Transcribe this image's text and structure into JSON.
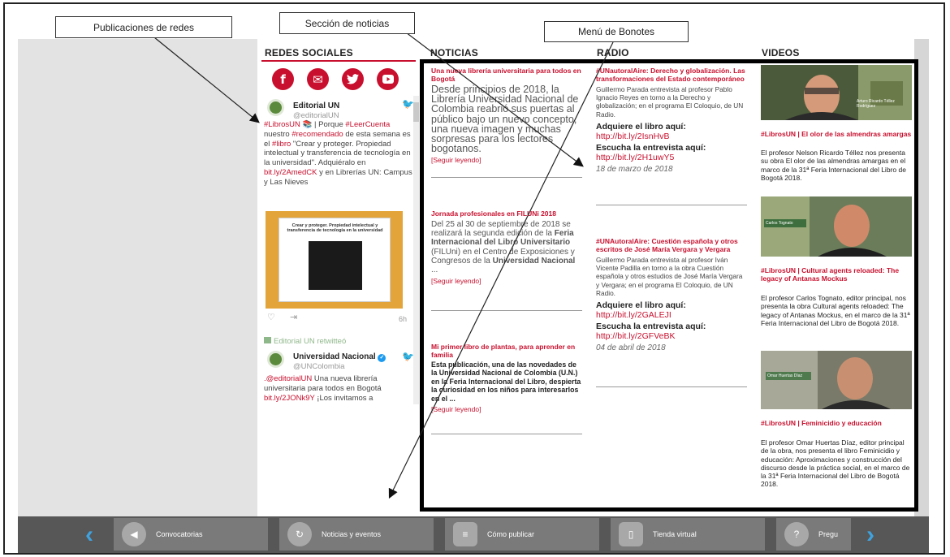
{
  "labels": {
    "networks": "Publicaciones de redes",
    "news": "Sección de noticias",
    "buttons": "Menú de Bonotes"
  },
  "columns": {
    "social": "REDES SOCIALES",
    "news": "NOTICIAS",
    "radio": "RADIO",
    "videos": "VIDEOS"
  },
  "social": {
    "icons": [
      "facebook-icon",
      "email-icon",
      "twitter-icon",
      "youtube-icon"
    ],
    "tweet1": {
      "name": "Editorial UN",
      "handle": "@editorialUN",
      "body_1": "#LibrosUN",
      "body_2": " 📚 | Porque ",
      "body_3": "#LeerCuenta",
      "body_4": " nuestro ",
      "body_5": "#recomendado",
      "body_6": " de esta semana es el ",
      "body_7": "#libro",
      "body_8": " \"Crear y proteger. Propiedad intelectual y transferencia de tecnología en la universidad\". Adquiéralo en ",
      "body_9": "bit.ly/2AmedCK",
      "body_10": " y en Librerías UN: Campus y Las Nieves",
      "book_title": "Crear y proteger. Propiedad intelectual y transferencia de tecnología en la universidad",
      "time": "6h"
    },
    "retweet": "Editorial UN retwitteó",
    "tweet2": {
      "name": "Universidad Nacional",
      "handle": "@UNColombia",
      "body_1": ".@editorialUN",
      "body_2": " Una nueva librería universitaria para todos en Bogotá ",
      "body_3": "bit.ly/2JONk9Y",
      "body_4": " ¡Los invitamos a"
    }
  },
  "news": [
    {
      "title": "Una nueva librería universitaria para todos en Bogotá",
      "body": "Desde principios de 2018, la Librería Universidad Nacional de Colombia reabrió sus puertas al público bajo un nuevo concepto, una nueva imagen y muchas sorpresas para los lectores bogotanos.",
      "more": "[Seguir leyendo]"
    },
    {
      "title": "Jornada profesionales en FILUNi 2018",
      "body_a": "Del 25 al 30 de septiembre de 2018 se realizará la segunda edición de la ",
      "body_b": "Feria Internacional del Libro Universitario",
      "body_c": " (FILUni) en el Centro de Exposiciones y Congresos de la ",
      "body_d": "Universidad Nacional",
      "body_e": " ...",
      "more": "[Seguir leyendo]"
    },
    {
      "title": "Mi primer libro de plantas, para aprender en familia",
      "body": "Esta publicación, una de las novedades de la Universidad Nacional de Colombia (U.N.) en la Feria Internacional del Libro, despierta la curiosidad en los niños para interesarlos en el ...",
      "more": "[Seguir leyendo]"
    }
  ],
  "radio": [
    {
      "title": "#UNautoralAire: Derecho y globalización. Las transformaciones del Estado contemporáneo",
      "body": "Guillermo Parada entrevista al profesor Pablo Ignacio Reyes en torno a la Derecho y globalización; en el programa El Coloquio, de UN Radio.",
      "buy_label": "Adquiere el libro aquí: ",
      "buy_link": "http://bit.ly/2IsnHvB",
      "listen_label": "Escucha la entrevista aquí: ",
      "listen_link": "http://bit.ly/2H1uwY5",
      "date": "18 de marzo de 2018"
    },
    {
      "title": "#UNAutoralAire: Cuestión española y otros escritos de José María Vergara y Vergara",
      "body": "Guillermo Parada entrevista al profesor Iván Vicente Padilla en torno a la obra Cuestión española y otros estudios de José María Vergara y Vergara; en el programa El Coloquio, de UN Radio.",
      "buy_label": "Adquiere el libro aquí: ",
      "buy_link": "http://bit.ly/2GALEJI",
      "listen_label": "Escucha la entrevista aquí: ",
      "listen_link": "http://bit.ly/2GFVeBK",
      "date": "04 de abril de 2018"
    }
  ],
  "videos": [
    {
      "thumb_caption": "Arturo Ricardo Téllez Rodríguez",
      "title": "#LibrosUN | El olor de las almendras amargas",
      "desc": "El profesor Nelson Ricardo Téllez nos presenta su obra El olor de las almendras amargas en el marco de la 31ª Feria Internacional del Libro de Bogotá 2018."
    },
    {
      "thumb_caption": "Carlos Tognato",
      "title": "#LibrosUN | Cultural agents reloaded: The legacy of Antanas Mockus",
      "desc": "El profesor Carlos Tognato, editor principal, nos presenta la obra Cultural agents reloaded: The legacy of Antanas Mockus, en el marco de la 31ª Feria Internacional del Libro de Bogotá 2018."
    },
    {
      "thumb_caption": "Omar Huertas Díaz",
      "title": "#LibrosUN | Feminicidio y educación",
      "desc": "El profesor Omar Huertas Díaz, editor principal de la obra, nos presenta el libro Feminicidio y educación: Aproximaciones y construcción del discurso desde la práctica social, en el marco de la 31ª Feria Internacional del Libro de Bogotá 2018."
    }
  ],
  "bottom": {
    "items": [
      {
        "label": "Convocatorias",
        "icon": "megaphone-icon"
      },
      {
        "label": "Noticias y eventos",
        "icon": "refresh-icon"
      },
      {
        "label": "Cómo publicar",
        "icon": "document-icon"
      },
      {
        "label": "Tienda virtual",
        "icon": "tablet-icon"
      },
      {
        "label": "Pregu",
        "icon": "question-icon"
      }
    ],
    "prev": "‹",
    "next": "›"
  },
  "colors": {
    "accent": "#c8102e",
    "nav_arrow": "#3fa3e0",
    "bar": "#575757"
  }
}
